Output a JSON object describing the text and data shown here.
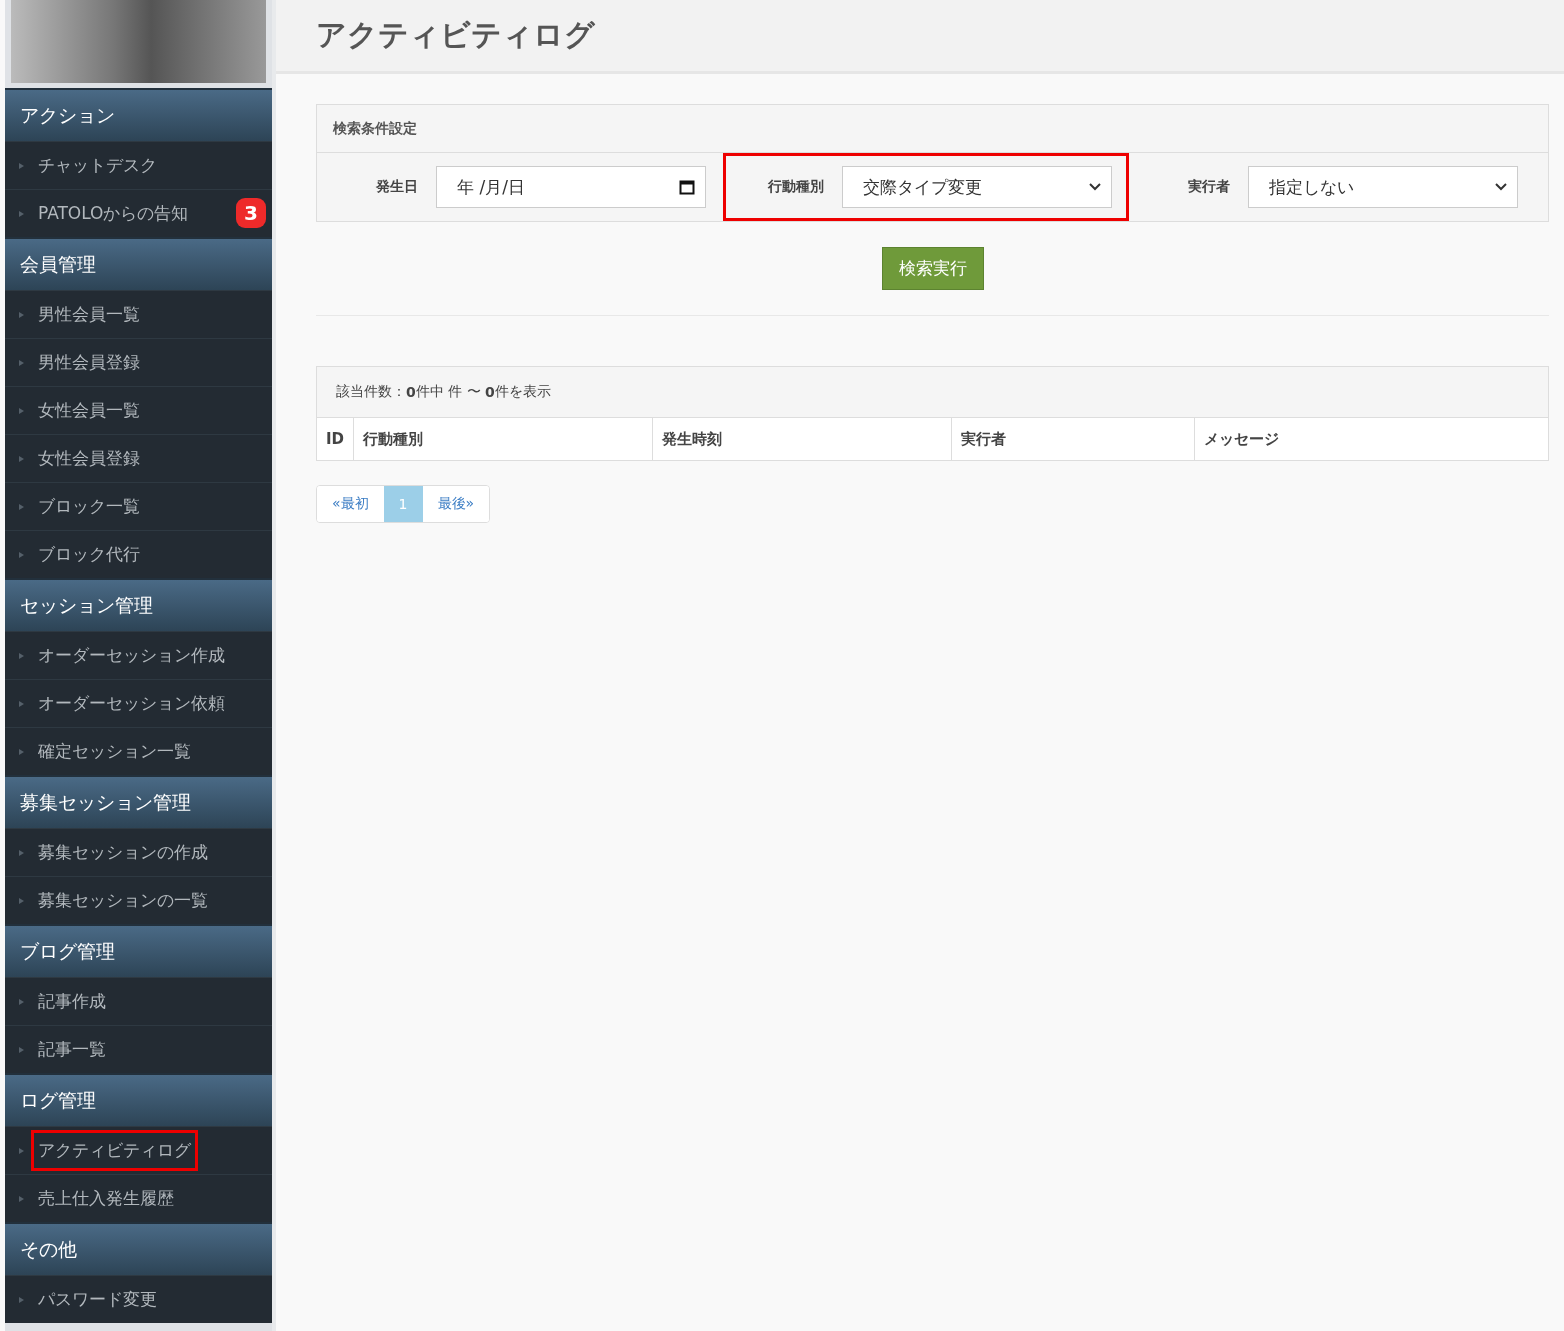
{
  "sidebar": {
    "sections": [
      {
        "title": "アクション",
        "items": [
          {
            "label": "チャットデスク",
            "selected": false,
            "highlighted": false
          },
          {
            "label": "PATOLOからの告知",
            "selected": false,
            "highlighted": false,
            "badge": "3"
          }
        ]
      },
      {
        "title": "会員管理",
        "items": [
          {
            "label": "男性会員一覧",
            "selected": false,
            "highlighted": false
          },
          {
            "label": "男性会員登録",
            "selected": false,
            "highlighted": false
          },
          {
            "label": "女性会員一覧",
            "selected": false,
            "highlighted": false
          },
          {
            "label": "女性会員登録",
            "selected": false,
            "highlighted": false
          },
          {
            "label": "ブロック一覧",
            "selected": false,
            "highlighted": false
          },
          {
            "label": "ブロック代行",
            "selected": false,
            "highlighted": false
          }
        ]
      },
      {
        "title": "セッション管理",
        "items": [
          {
            "label": "オーダーセッション作成",
            "selected": false,
            "highlighted": false
          },
          {
            "label": "オーダーセッション依頼",
            "selected": false,
            "highlighted": false
          },
          {
            "label": "確定セッション一覧",
            "selected": false,
            "highlighted": false
          }
        ]
      },
      {
        "title": "募集セッション管理",
        "items": [
          {
            "label": "募集セッションの作成",
            "selected": false,
            "highlighted": false
          },
          {
            "label": "募集セッションの一覧",
            "selected": false,
            "highlighted": false
          }
        ]
      },
      {
        "title": "ブログ管理",
        "items": [
          {
            "label": "記事作成",
            "selected": false,
            "highlighted": false
          },
          {
            "label": "記事一覧",
            "selected": false,
            "highlighted": false
          }
        ]
      },
      {
        "title": "ログ管理",
        "items": [
          {
            "label": "アクティビティログ",
            "selected": false,
            "highlighted": true
          },
          {
            "label": "売上仕入発生履歴",
            "selected": false,
            "highlighted": false
          }
        ]
      },
      {
        "title": "その他",
        "items": [
          {
            "label": "パスワード変更",
            "selected": false,
            "highlighted": false
          }
        ]
      }
    ]
  },
  "page_title": "アクティビティログ",
  "search": {
    "title": "検索条件設定",
    "filters": [
      {
        "kind": "date",
        "label": "発生日",
        "value": "年 /月/日",
        "highlighted": false
      },
      {
        "kind": "select",
        "label": "行動種別",
        "value": "交際タイプ変更",
        "highlighted": true
      },
      {
        "kind": "select",
        "label": "実行者",
        "value": "指定しない",
        "highlighted": false
      }
    ],
    "button": "検索実行"
  },
  "results": {
    "summary": "該当件数：**0**件中 件 〜 **0**件を表示",
    "columns": [
      "ID",
      "行動種別",
      "発生時刻",
      "実行者",
      "メッセージ"
    ]
  },
  "pagination": [
    {
      "label": "«最初",
      "selected": false
    },
    {
      "label": "1",
      "selected": true
    },
    {
      "label": "最後»",
      "selected": false
    }
  ]
}
